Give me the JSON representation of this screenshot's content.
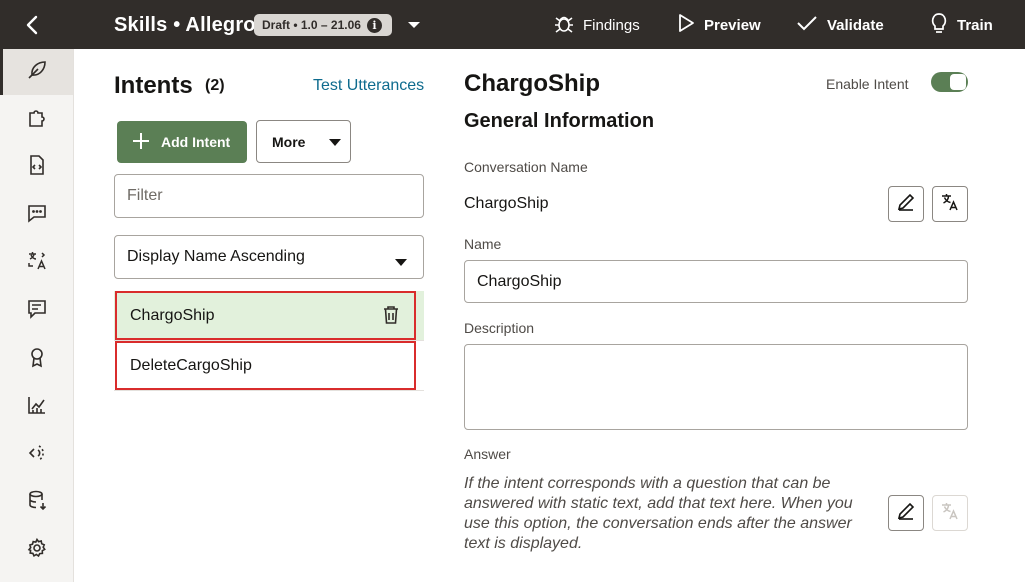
{
  "header": {
    "title": "Skills • Allegro",
    "badge": "Draft • 1.0 – 21.06",
    "badge_info_icon": "info-icon",
    "actions": [
      {
        "label": "Findings",
        "icon": "bug-icon"
      },
      {
        "label": "Preview",
        "icon": "play-icon"
      },
      {
        "label": "Validate",
        "icon": "check-icon"
      },
      {
        "label": "Train",
        "icon": "lightbulb-icon"
      }
    ]
  },
  "rail": {
    "items": [
      "feather-icon",
      "puzzle-icon",
      "code-file-icon",
      "chat-icon",
      "translate-icon",
      "comment-list-icon",
      "badge-icon",
      "analytics-icon",
      "channels-icon",
      "database-icon",
      "settings-icon"
    ],
    "active_index": 0
  },
  "intents": {
    "title": "Intents",
    "count": "(2)",
    "test_utterances": "Test Utterances",
    "add_label": "Add Intent",
    "more_label": "More",
    "filter_placeholder": "Filter",
    "sort_label": "Display Name Ascending",
    "items": [
      {
        "label": "ChargoShip",
        "selected": true
      },
      {
        "label": "DeleteCargoShip",
        "selected": false
      }
    ]
  },
  "detail": {
    "title": "ChargoShip",
    "enable_label": "Enable Intent",
    "enabled": true,
    "section_title": "General Information",
    "conversation_name_label": "Conversation Name",
    "conversation_name_value": "ChargoShip",
    "name_label": "Name",
    "name_value": "ChargoShip",
    "description_label": "Description",
    "description_value": "",
    "answer_label": "Answer",
    "answer_help": "If the intent corresponds with a question that can be answered with static text, add that text here. When you use this option, the conversation ends after the answer text is displayed."
  },
  "colors": {
    "topbar": "#312d2a",
    "accent_green": "#5b7f55",
    "selected_row": "#e2f1dc",
    "highlight_red": "#d92c2c",
    "link": "#0e6b8e"
  }
}
